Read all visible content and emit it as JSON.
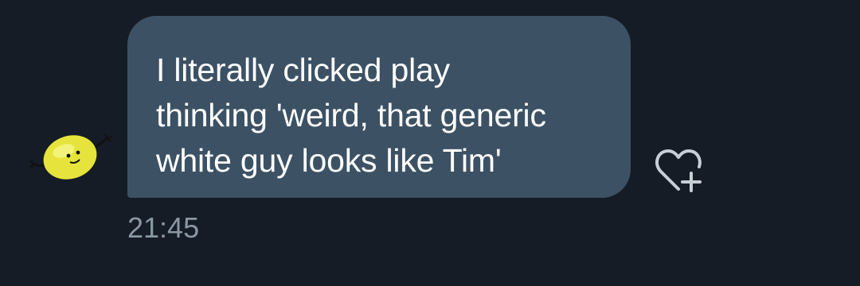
{
  "message": {
    "lines": [
      "I literally clicked play",
      "thinking 'weird, that generic",
      "white guy looks like Tim'"
    ],
    "timestamp": "21:45",
    "bubble_color": "#3c5164",
    "text_color": "#ffffff"
  },
  "sender": {
    "avatar_icon": "lemon-character-icon"
  },
  "reaction": {
    "icon": "heart-plus-icon"
  },
  "theme": {
    "background": "#151c25",
    "timestamp_color": "#8a97a3"
  }
}
